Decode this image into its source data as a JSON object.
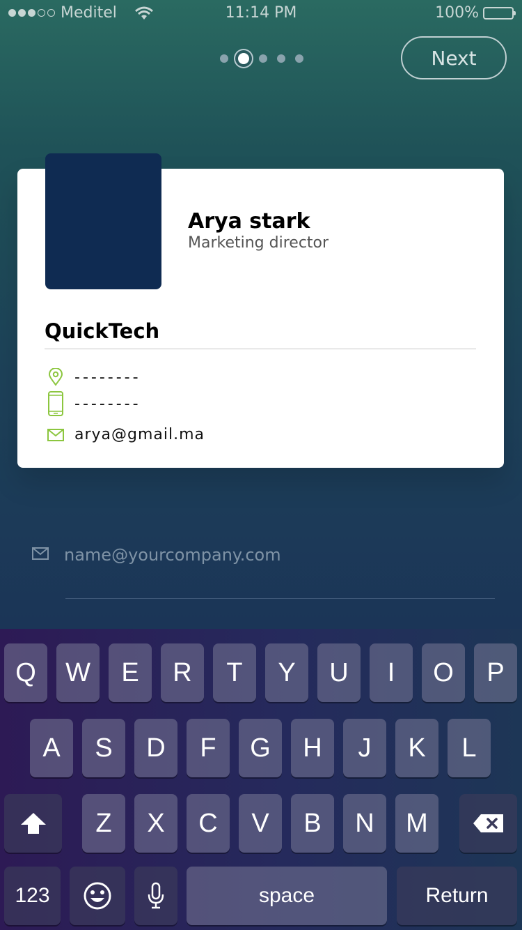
{
  "status_bar": {
    "carrier": "Meditel",
    "time": "11:14 PM",
    "battery": "100%",
    "signal_bars_filled": 3,
    "signal_bars_total": 5
  },
  "onboarding": {
    "page_count": 5,
    "current_page": 2,
    "next_label": "Next"
  },
  "card": {
    "name": "Arya stark",
    "role": "Marketing director",
    "company": "QuickTech",
    "address": "--------",
    "phone": "--------",
    "email": "arya@gmail.ma",
    "avatar_color": "#0f2b52",
    "icon_color": "#8cc63f"
  },
  "email_input": {
    "placeholder": "name@yourcompany.com",
    "value": ""
  },
  "keyboard": {
    "row1": [
      "Q",
      "W",
      "E",
      "R",
      "T",
      "Y",
      "U",
      "I",
      "O",
      "P"
    ],
    "row2": [
      "A",
      "S",
      "D",
      "F",
      "G",
      "H",
      "J",
      "K",
      "L"
    ],
    "row3": [
      "Z",
      "X",
      "C",
      "V",
      "B",
      "N",
      "M"
    ],
    "numbers_label": "123",
    "space_label": "space",
    "return_label": "Return"
  }
}
